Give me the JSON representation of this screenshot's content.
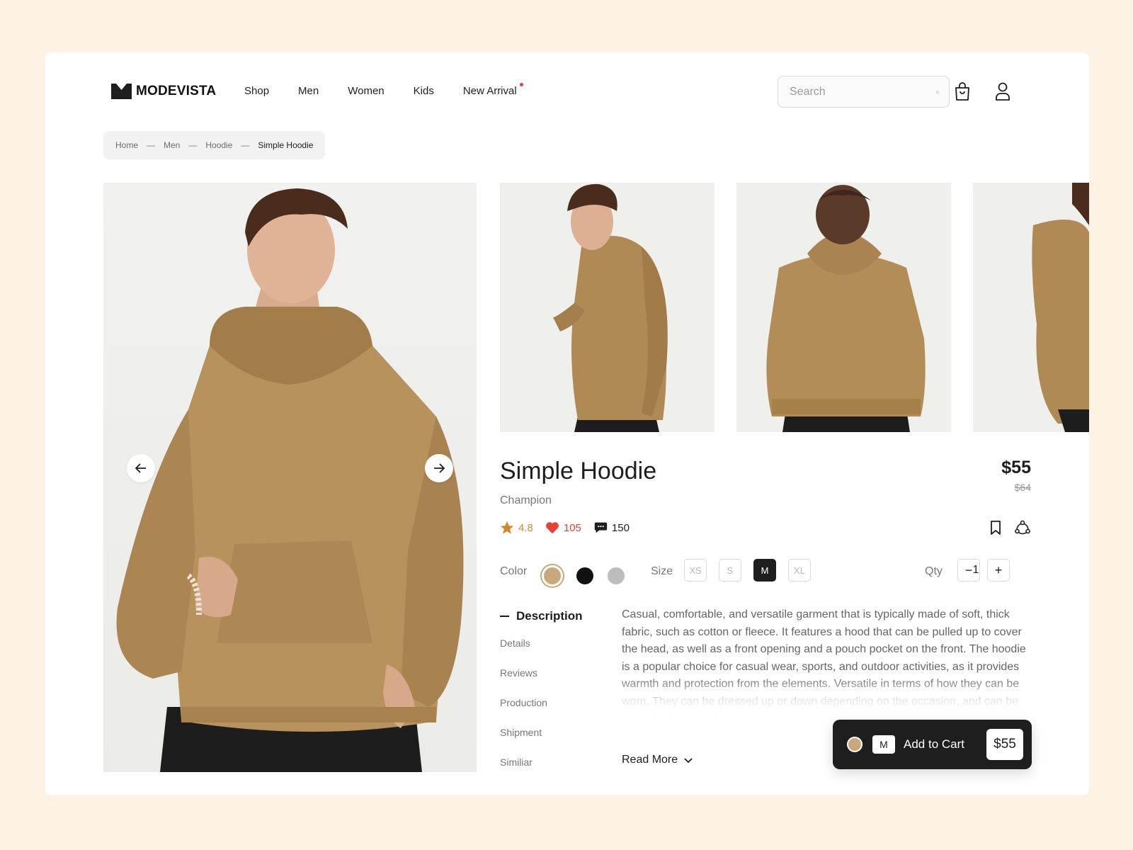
{
  "colors": {
    "background": "#fdf2e4",
    "accent_tan": "#c8a97a",
    "rating_orange": "#d2892e",
    "likes_red": "#e8413a",
    "dark": "#1e1e1e"
  },
  "header": {
    "logo_text": "MODEVISTA",
    "nav": [
      "Shop",
      "Men",
      "Women",
      "Kids",
      "New Arrival"
    ],
    "search_placeholder": "Search",
    "icons": [
      "search-icon",
      "shopping-bag-icon",
      "user-icon"
    ]
  },
  "breadcrumb": [
    "Home",
    "Men",
    "Hoodie",
    "Simple Hoodie"
  ],
  "breadcrumb_separator": "—",
  "product": {
    "title": "Simple Hoodie",
    "brand": "Champion",
    "price": "$55",
    "old_price": "$64",
    "rating": "4.8",
    "likes": "105",
    "comments": "150"
  },
  "options": {
    "color_label": "Color",
    "colors": [
      "#c8a97a",
      "#111111",
      "#bdbdbd"
    ],
    "selected_color": "#c8a97a",
    "size_label": "Size",
    "sizes": [
      "XS",
      "S",
      "M",
      "XL"
    ],
    "selected_size": "M",
    "qty_label": "Qty",
    "qty": "1",
    "qty_minus": "−",
    "qty_plus": "+"
  },
  "tabs": {
    "active": "Description",
    "items": [
      "Details",
      "Reviews",
      "Production",
      "Shipment",
      "Similiar"
    ]
  },
  "description": "Casual, comfortable, and versatile garment that is typically made of soft, thick fabric, such as cotton or fleece. It features a hood that can be pulled up to cover the head, as well as a front opening and a pouch pocket on the front. The hoodie is a popular choice for casual wear, sports, and outdoor activities, as it provides warmth and protection from the elements. Versatile in terms of how they can be worn. They can be dressed up or down depending on the occasion, and can be paired with jeans, leggings, shorts, or",
  "read_more": "Read More",
  "cart": {
    "size": "M",
    "label": "Add to Cart",
    "price": "$55"
  }
}
